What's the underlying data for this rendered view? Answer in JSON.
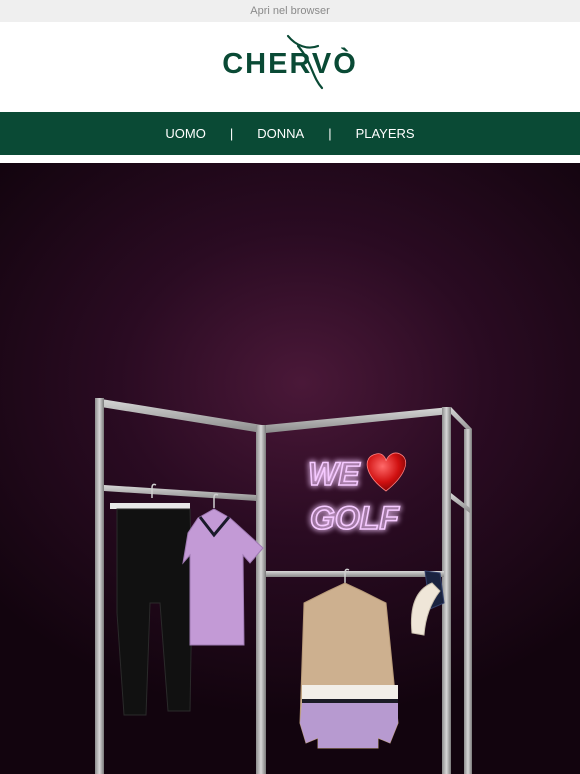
{
  "browser_link": "Apri nel browser",
  "brand": {
    "logo_text": "CHERVÒ"
  },
  "nav": {
    "items": [
      "UOMO",
      "DONNA",
      "PLAYERS"
    ],
    "separator": "|"
  },
  "hero": {
    "neon_line1": "WE",
    "neon_line2": "GOLF",
    "neon_color": "#f3c2ff",
    "heart_color": "#e01818"
  },
  "colors": {
    "brand_green": "#0a4a35",
    "topbar_bg": "#efefef"
  }
}
